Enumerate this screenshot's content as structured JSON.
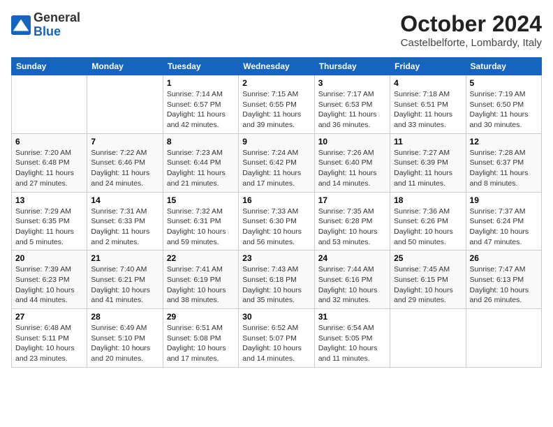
{
  "header": {
    "logo": {
      "general": "General",
      "blue": "Blue"
    },
    "title": "October 2024",
    "location": "Castelbelforte, Lombardy, Italy"
  },
  "days_of_week": [
    "Sunday",
    "Monday",
    "Tuesday",
    "Wednesday",
    "Thursday",
    "Friday",
    "Saturday"
  ],
  "weeks": [
    [
      {
        "day": "",
        "sunrise": "",
        "sunset": "",
        "daylight": ""
      },
      {
        "day": "",
        "sunrise": "",
        "sunset": "",
        "daylight": ""
      },
      {
        "day": "1",
        "sunrise": "Sunrise: 7:14 AM",
        "sunset": "Sunset: 6:57 PM",
        "daylight": "Daylight: 11 hours and 42 minutes."
      },
      {
        "day": "2",
        "sunrise": "Sunrise: 7:15 AM",
        "sunset": "Sunset: 6:55 PM",
        "daylight": "Daylight: 11 hours and 39 minutes."
      },
      {
        "day": "3",
        "sunrise": "Sunrise: 7:17 AM",
        "sunset": "Sunset: 6:53 PM",
        "daylight": "Daylight: 11 hours and 36 minutes."
      },
      {
        "day": "4",
        "sunrise": "Sunrise: 7:18 AM",
        "sunset": "Sunset: 6:51 PM",
        "daylight": "Daylight: 11 hours and 33 minutes."
      },
      {
        "day": "5",
        "sunrise": "Sunrise: 7:19 AM",
        "sunset": "Sunset: 6:50 PM",
        "daylight": "Daylight: 11 hours and 30 minutes."
      }
    ],
    [
      {
        "day": "6",
        "sunrise": "Sunrise: 7:20 AM",
        "sunset": "Sunset: 6:48 PM",
        "daylight": "Daylight: 11 hours and 27 minutes."
      },
      {
        "day": "7",
        "sunrise": "Sunrise: 7:22 AM",
        "sunset": "Sunset: 6:46 PM",
        "daylight": "Daylight: 11 hours and 24 minutes."
      },
      {
        "day": "8",
        "sunrise": "Sunrise: 7:23 AM",
        "sunset": "Sunset: 6:44 PM",
        "daylight": "Daylight: 11 hours and 21 minutes."
      },
      {
        "day": "9",
        "sunrise": "Sunrise: 7:24 AM",
        "sunset": "Sunset: 6:42 PM",
        "daylight": "Daylight: 11 hours and 17 minutes."
      },
      {
        "day": "10",
        "sunrise": "Sunrise: 7:26 AM",
        "sunset": "Sunset: 6:40 PM",
        "daylight": "Daylight: 11 hours and 14 minutes."
      },
      {
        "day": "11",
        "sunrise": "Sunrise: 7:27 AM",
        "sunset": "Sunset: 6:39 PM",
        "daylight": "Daylight: 11 hours and 11 minutes."
      },
      {
        "day": "12",
        "sunrise": "Sunrise: 7:28 AM",
        "sunset": "Sunset: 6:37 PM",
        "daylight": "Daylight: 11 hours and 8 minutes."
      }
    ],
    [
      {
        "day": "13",
        "sunrise": "Sunrise: 7:29 AM",
        "sunset": "Sunset: 6:35 PM",
        "daylight": "Daylight: 11 hours and 5 minutes."
      },
      {
        "day": "14",
        "sunrise": "Sunrise: 7:31 AM",
        "sunset": "Sunset: 6:33 PM",
        "daylight": "Daylight: 11 hours and 2 minutes."
      },
      {
        "day": "15",
        "sunrise": "Sunrise: 7:32 AM",
        "sunset": "Sunset: 6:31 PM",
        "daylight": "Daylight: 10 hours and 59 minutes."
      },
      {
        "day": "16",
        "sunrise": "Sunrise: 7:33 AM",
        "sunset": "Sunset: 6:30 PM",
        "daylight": "Daylight: 10 hours and 56 minutes."
      },
      {
        "day": "17",
        "sunrise": "Sunrise: 7:35 AM",
        "sunset": "Sunset: 6:28 PM",
        "daylight": "Daylight: 10 hours and 53 minutes."
      },
      {
        "day": "18",
        "sunrise": "Sunrise: 7:36 AM",
        "sunset": "Sunset: 6:26 PM",
        "daylight": "Daylight: 10 hours and 50 minutes."
      },
      {
        "day": "19",
        "sunrise": "Sunrise: 7:37 AM",
        "sunset": "Sunset: 6:24 PM",
        "daylight": "Daylight: 10 hours and 47 minutes."
      }
    ],
    [
      {
        "day": "20",
        "sunrise": "Sunrise: 7:39 AM",
        "sunset": "Sunset: 6:23 PM",
        "daylight": "Daylight: 10 hours and 44 minutes."
      },
      {
        "day": "21",
        "sunrise": "Sunrise: 7:40 AM",
        "sunset": "Sunset: 6:21 PM",
        "daylight": "Daylight: 10 hours and 41 minutes."
      },
      {
        "day": "22",
        "sunrise": "Sunrise: 7:41 AM",
        "sunset": "Sunset: 6:19 PM",
        "daylight": "Daylight: 10 hours and 38 minutes."
      },
      {
        "day": "23",
        "sunrise": "Sunrise: 7:43 AM",
        "sunset": "Sunset: 6:18 PM",
        "daylight": "Daylight: 10 hours and 35 minutes."
      },
      {
        "day": "24",
        "sunrise": "Sunrise: 7:44 AM",
        "sunset": "Sunset: 6:16 PM",
        "daylight": "Daylight: 10 hours and 32 minutes."
      },
      {
        "day": "25",
        "sunrise": "Sunrise: 7:45 AM",
        "sunset": "Sunset: 6:15 PM",
        "daylight": "Daylight: 10 hours and 29 minutes."
      },
      {
        "day": "26",
        "sunrise": "Sunrise: 7:47 AM",
        "sunset": "Sunset: 6:13 PM",
        "daylight": "Daylight: 10 hours and 26 minutes."
      }
    ],
    [
      {
        "day": "27",
        "sunrise": "Sunrise: 6:48 AM",
        "sunset": "Sunset: 5:11 PM",
        "daylight": "Daylight: 10 hours and 23 minutes."
      },
      {
        "day": "28",
        "sunrise": "Sunrise: 6:49 AM",
        "sunset": "Sunset: 5:10 PM",
        "daylight": "Daylight: 10 hours and 20 minutes."
      },
      {
        "day": "29",
        "sunrise": "Sunrise: 6:51 AM",
        "sunset": "Sunset: 5:08 PM",
        "daylight": "Daylight: 10 hours and 17 minutes."
      },
      {
        "day": "30",
        "sunrise": "Sunrise: 6:52 AM",
        "sunset": "Sunset: 5:07 PM",
        "daylight": "Daylight: 10 hours and 14 minutes."
      },
      {
        "day": "31",
        "sunrise": "Sunrise: 6:54 AM",
        "sunset": "Sunset: 5:05 PM",
        "daylight": "Daylight: 10 hours and 11 minutes."
      },
      {
        "day": "",
        "sunrise": "",
        "sunset": "",
        "daylight": ""
      },
      {
        "day": "",
        "sunrise": "",
        "sunset": "",
        "daylight": ""
      }
    ]
  ]
}
